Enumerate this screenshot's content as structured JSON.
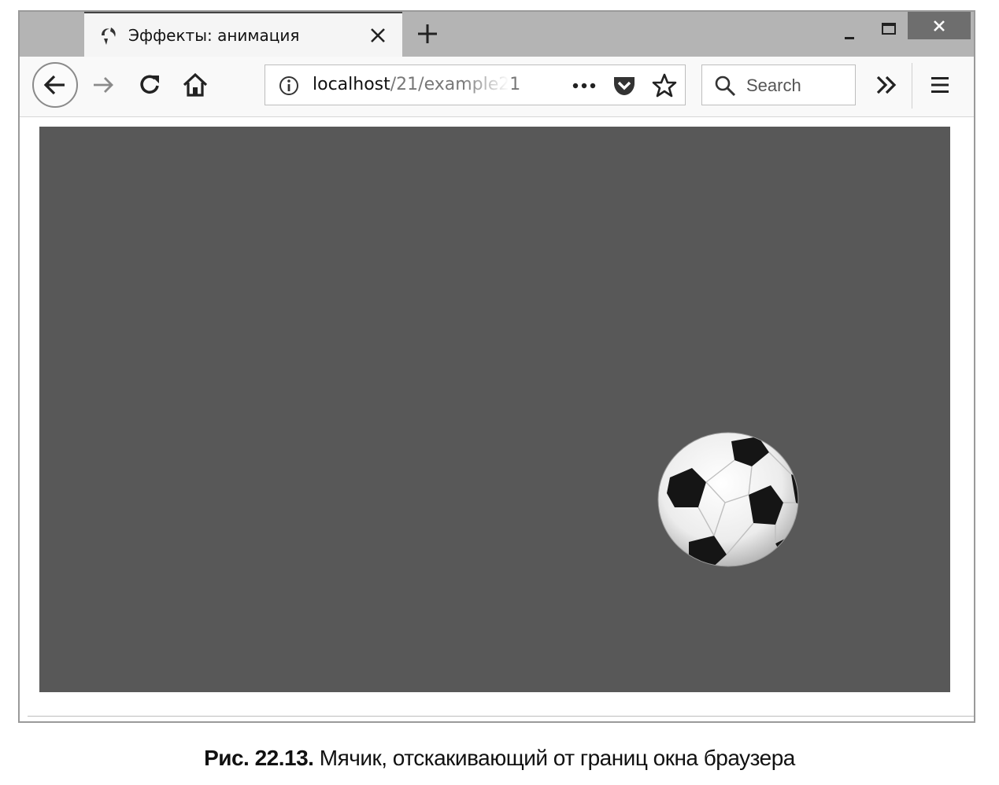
{
  "tab": {
    "title": "Эффекты: анимация"
  },
  "address_bar": {
    "host": "localhost",
    "path": "/21/example21"
  },
  "search": {
    "placeholder": "Search"
  },
  "caption": {
    "number": "Рис. 22.13.",
    "text": "Мячик, отскакивающий от границ окна браузера"
  },
  "icons": [
    "favicon-icon",
    "tab-close-icon",
    "new-tab-icon",
    "minimize-icon",
    "maximize-icon",
    "close-window-icon",
    "back-arrow-icon",
    "forward-arrow-icon",
    "reload-icon",
    "home-icon",
    "info-icon",
    "page-actions-icon",
    "pocket-icon",
    "bookmark-star-icon",
    "search-icon",
    "overflow-chevron-icon",
    "hamburger-menu-icon"
  ],
  "colors": {
    "page_background": "#585858",
    "titlebar": "#b4b4b4",
    "tab_active": "#f5f5f5",
    "close_button": "#6e6e6e"
  }
}
